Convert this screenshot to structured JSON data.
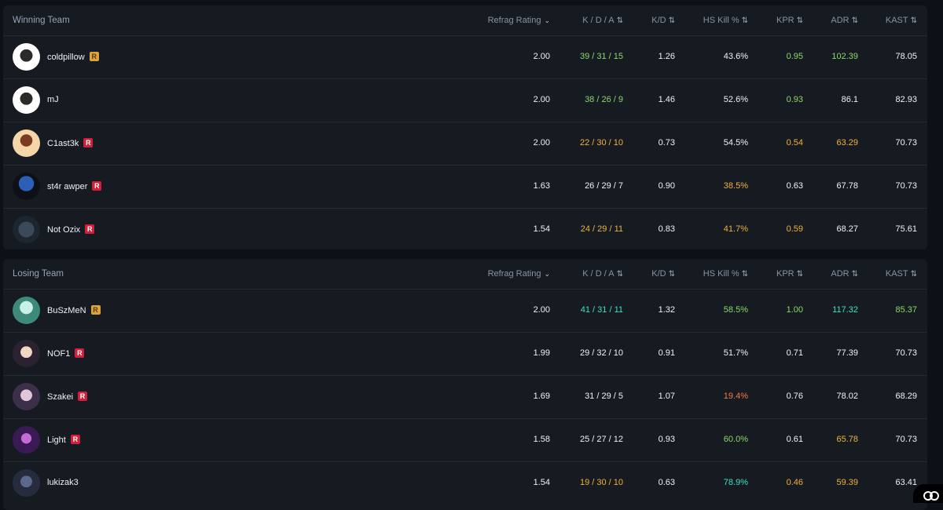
{
  "columns": {
    "rating": "Refrag Rating",
    "kda": "K / D / A",
    "kd": "K/D",
    "hs": "HS Kill %",
    "kpr": "KPR",
    "adr": "ADR",
    "kast": "KAST"
  },
  "icons": {
    "sort": "sort-arrows-icon",
    "chevron": "chevron-down-icon",
    "badge": "refrag-badge-icon",
    "logo": "corner-logo-icon"
  },
  "colors": {
    "green": "#8bd86a",
    "orange": "#f0b23a",
    "teal": "#3ee0c2",
    "red": "#f07a45",
    "white": "#f0f2f5",
    "badge_red": "#d11f3c",
    "badge_gold": "#d9a441"
  },
  "teams": [
    {
      "title": "Winning Team",
      "players": [
        {
          "name": "coldpillow",
          "badge": "gold",
          "rating": "2.00",
          "kda": "39 / 31 / 15",
          "kda_c": "green",
          "kd": "1.26",
          "kd_c": "white",
          "hs": "43.6%",
          "hs_c": "white",
          "kpr": "0.95",
          "kpr_c": "green",
          "adr": "102.39",
          "adr_c": "green",
          "kast": "78.05",
          "kast_c": "white"
        },
        {
          "name": "mJ",
          "badge": "none",
          "rating": "2.00",
          "kda": "38 / 26 / 9",
          "kda_c": "green",
          "kd": "1.46",
          "kd_c": "white",
          "hs": "52.6%",
          "hs_c": "white",
          "kpr": "0.93",
          "kpr_c": "green",
          "adr": "86.1",
          "adr_c": "white",
          "kast": "82.93",
          "kast_c": "white"
        },
        {
          "name": "C1ast3k",
          "badge": "red",
          "rating": "2.00",
          "kda": "22 / 30 / 10",
          "kda_c": "orange",
          "kd": "0.73",
          "kd_c": "white",
          "hs": "54.5%",
          "hs_c": "white",
          "kpr": "0.54",
          "kpr_c": "orange",
          "adr": "63.29",
          "adr_c": "orange",
          "kast": "70.73",
          "kast_c": "white"
        },
        {
          "name": "st4r awper",
          "badge": "red",
          "rating": "1.63",
          "kda": "26 / 29 / 7",
          "kda_c": "white",
          "kd": "0.90",
          "kd_c": "white",
          "hs": "38.5%",
          "hs_c": "orange",
          "kpr": "0.63",
          "kpr_c": "white",
          "adr": "67.78",
          "adr_c": "white",
          "kast": "70.73",
          "kast_c": "white"
        },
        {
          "name": "Not Ozix",
          "badge": "red",
          "rating": "1.54",
          "kda": "24 / 29 / 11",
          "kda_c": "orange",
          "kd": "0.83",
          "kd_c": "white",
          "hs": "41.7%",
          "hs_c": "orange",
          "kpr": "0.59",
          "kpr_c": "orange",
          "adr": "68.27",
          "adr_c": "white",
          "kast": "75.61",
          "kast_c": "white"
        }
      ]
    },
    {
      "title": "Losing Team",
      "players": [
        {
          "name": "BuSzMeN",
          "badge": "gold",
          "rating": "2.00",
          "kda": "41 / 31 / 11",
          "kda_c": "teal",
          "kd": "1.32",
          "kd_c": "white",
          "hs": "58.5%",
          "hs_c": "green",
          "kpr": "1.00",
          "kpr_c": "green",
          "adr": "117.32",
          "adr_c": "teal",
          "kast": "85.37",
          "kast_c": "green"
        },
        {
          "name": "NOF1",
          "badge": "red",
          "rating": "1.99",
          "kda": "29 / 32 / 10",
          "kda_c": "white",
          "kd": "0.91",
          "kd_c": "white",
          "hs": "51.7%",
          "hs_c": "white",
          "kpr": "0.71",
          "kpr_c": "white",
          "adr": "77.39",
          "adr_c": "white",
          "kast": "70.73",
          "kast_c": "white"
        },
        {
          "name": "Szakei",
          "badge": "red",
          "rating": "1.69",
          "kda": "31 / 29 / 5",
          "kda_c": "white",
          "kd": "1.07",
          "kd_c": "white",
          "hs": "19.4%",
          "hs_c": "red",
          "kpr": "0.76",
          "kpr_c": "white",
          "adr": "78.02",
          "adr_c": "white",
          "kast": "68.29",
          "kast_c": "white"
        },
        {
          "name": "Light",
          "badge": "red",
          "rating": "1.58",
          "kda": "25 / 27 / 12",
          "kda_c": "white",
          "kd": "0.93",
          "kd_c": "white",
          "hs": "60.0%",
          "hs_c": "green",
          "kpr": "0.61",
          "kpr_c": "white",
          "adr": "65.78",
          "adr_c": "orange",
          "kast": "70.73",
          "kast_c": "white"
        },
        {
          "name": "lukizak3",
          "badge": "none",
          "rating": "1.54",
          "kda": "19 / 30 / 10",
          "kda_c": "orange",
          "kd": "0.63",
          "kd_c": "white",
          "hs": "78.9%",
          "hs_c": "teal",
          "kpr": "0.46",
          "kpr_c": "orange",
          "adr": "59.39",
          "adr_c": "orange",
          "kast": "63.41",
          "kast_c": "white"
        }
      ]
    }
  ]
}
